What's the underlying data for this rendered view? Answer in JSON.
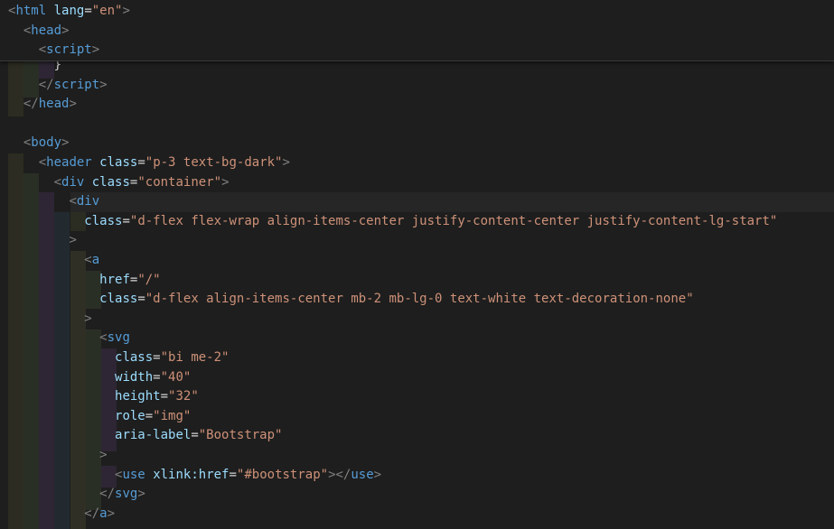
{
  "editor": {
    "language": "html",
    "theme": {
      "background": "#1e1e1e",
      "tag": "#569cd6",
      "attribute": "#9cdcfe",
      "string": "#ce9178",
      "punctuation": "#808080"
    }
  },
  "sticky_lines": [
    {
      "tokens": [
        {
          "t": "punc",
          "v": "<"
        },
        {
          "t": "tag",
          "v": "html"
        },
        {
          "t": "plain",
          "v": " "
        },
        {
          "t": "attr",
          "v": "lang"
        },
        {
          "t": "eq",
          "v": "="
        },
        {
          "t": "str",
          "v": "\"en\""
        },
        {
          "t": "punc",
          "v": ">"
        }
      ]
    },
    {
      "tokens": [
        {
          "t": "plain",
          "v": "  "
        },
        {
          "t": "punc",
          "v": "<"
        },
        {
          "t": "tag",
          "v": "head"
        },
        {
          "t": "punc",
          "v": ">"
        }
      ]
    },
    {
      "tokens": [
        {
          "t": "plain",
          "v": "    "
        },
        {
          "t": "punc",
          "v": "<"
        },
        {
          "t": "tag",
          "v": "script"
        },
        {
          "t": "punc",
          "v": ">"
        }
      ]
    }
  ],
  "lines": [
    {
      "tokens": [
        {
          "t": "plain",
          "v": "      }"
        }
      ]
    },
    {
      "tokens": [
        {
          "t": "plain",
          "v": "    "
        },
        {
          "t": "punc",
          "v": "</"
        },
        {
          "t": "tag",
          "v": "script"
        },
        {
          "t": "punc",
          "v": ">"
        }
      ]
    },
    {
      "tokens": [
        {
          "t": "plain",
          "v": "  "
        },
        {
          "t": "punc",
          "v": "</"
        },
        {
          "t": "tag",
          "v": "head"
        },
        {
          "t": "punc",
          "v": ">"
        }
      ]
    },
    {
      "tokens": []
    },
    {
      "tokens": [
        {
          "t": "plain",
          "v": "  "
        },
        {
          "t": "punc",
          "v": "<"
        },
        {
          "t": "tag",
          "v": "body"
        },
        {
          "t": "punc",
          "v": ">"
        }
      ]
    },
    {
      "tokens": [
        {
          "t": "plain",
          "v": "    "
        },
        {
          "t": "punc",
          "v": "<"
        },
        {
          "t": "tag",
          "v": "header"
        },
        {
          "t": "plain",
          "v": " "
        },
        {
          "t": "attr",
          "v": "class"
        },
        {
          "t": "eq",
          "v": "="
        },
        {
          "t": "str",
          "v": "\"p-3 text-bg-dark\""
        },
        {
          "t": "punc",
          "v": ">"
        }
      ]
    },
    {
      "tokens": [
        {
          "t": "plain",
          "v": "      "
        },
        {
          "t": "punc",
          "v": "<"
        },
        {
          "t": "tag",
          "v": "div"
        },
        {
          "t": "plain",
          "v": " "
        },
        {
          "t": "attr",
          "v": "class"
        },
        {
          "t": "eq",
          "v": "="
        },
        {
          "t": "str",
          "v": "\"container\""
        },
        {
          "t": "punc",
          "v": ">"
        }
      ]
    },
    {
      "tokens": [
        {
          "t": "plain",
          "v": "        "
        },
        {
          "t": "punc",
          "v": "<"
        },
        {
          "t": "tag",
          "v": "div"
        }
      ]
    },
    {
      "tokens": [
        {
          "t": "plain",
          "v": "          "
        },
        {
          "t": "attr",
          "v": "class"
        },
        {
          "t": "eq",
          "v": "="
        },
        {
          "t": "str",
          "v": "\"d-flex flex-wrap align-items-center justify-content-center justify-content-lg-start\""
        }
      ]
    },
    {
      "tokens": [
        {
          "t": "plain",
          "v": "        "
        },
        {
          "t": "punc",
          "v": ">"
        }
      ]
    },
    {
      "tokens": [
        {
          "t": "plain",
          "v": "          "
        },
        {
          "t": "punc",
          "v": "<"
        },
        {
          "t": "tag",
          "v": "a"
        }
      ]
    },
    {
      "tokens": [
        {
          "t": "plain",
          "v": "            "
        },
        {
          "t": "attr",
          "v": "href"
        },
        {
          "t": "eq",
          "v": "="
        },
        {
          "t": "str",
          "v": "\"/\""
        }
      ]
    },
    {
      "tokens": [
        {
          "t": "plain",
          "v": "            "
        },
        {
          "t": "attr",
          "v": "class"
        },
        {
          "t": "eq",
          "v": "="
        },
        {
          "t": "str",
          "v": "\"d-flex align-items-center mb-2 mb-lg-0 text-white text-decoration-none\""
        }
      ]
    },
    {
      "tokens": [
        {
          "t": "plain",
          "v": "          "
        },
        {
          "t": "punc",
          "v": ">"
        }
      ]
    },
    {
      "tokens": [
        {
          "t": "plain",
          "v": "            "
        },
        {
          "t": "punc",
          "v": "<"
        },
        {
          "t": "tag",
          "v": "svg"
        }
      ]
    },
    {
      "tokens": [
        {
          "t": "plain",
          "v": "              "
        },
        {
          "t": "attr",
          "v": "class"
        },
        {
          "t": "eq",
          "v": "="
        },
        {
          "t": "str",
          "v": "\"bi me-2\""
        }
      ]
    },
    {
      "tokens": [
        {
          "t": "plain",
          "v": "              "
        },
        {
          "t": "attr",
          "v": "width"
        },
        {
          "t": "eq",
          "v": "="
        },
        {
          "t": "str",
          "v": "\"40\""
        }
      ]
    },
    {
      "tokens": [
        {
          "t": "plain",
          "v": "              "
        },
        {
          "t": "attr",
          "v": "height"
        },
        {
          "t": "eq",
          "v": "="
        },
        {
          "t": "str",
          "v": "\"32\""
        }
      ]
    },
    {
      "tokens": [
        {
          "t": "plain",
          "v": "              "
        },
        {
          "t": "attr",
          "v": "role"
        },
        {
          "t": "eq",
          "v": "="
        },
        {
          "t": "str",
          "v": "\"img\""
        }
      ]
    },
    {
      "tokens": [
        {
          "t": "plain",
          "v": "              "
        },
        {
          "t": "attr",
          "v": "aria-label"
        },
        {
          "t": "eq",
          "v": "="
        },
        {
          "t": "str",
          "v": "\"Bootstrap\""
        }
      ]
    },
    {
      "tokens": [
        {
          "t": "plain",
          "v": "            "
        },
        {
          "t": "punc",
          "v": ">"
        }
      ]
    },
    {
      "tokens": [
        {
          "t": "plain",
          "v": "              "
        },
        {
          "t": "punc",
          "v": "<"
        },
        {
          "t": "tag",
          "v": "use"
        },
        {
          "t": "plain",
          "v": " "
        },
        {
          "t": "attr",
          "v": "xlink:href"
        },
        {
          "t": "eq",
          "v": "="
        },
        {
          "t": "str",
          "v": "\"#bootstrap\""
        },
        {
          "t": "punc",
          "v": "></"
        },
        {
          "t": "tag",
          "v": "use"
        },
        {
          "t": "punc",
          "v": ">"
        }
      ]
    },
    {
      "tokens": [
        {
          "t": "plain",
          "v": "            "
        },
        {
          "t": "punc",
          "v": "</"
        },
        {
          "t": "tag",
          "v": "svg"
        },
        {
          "t": "punc",
          "v": ">"
        }
      ]
    },
    {
      "tokens": [
        {
          "t": "plain",
          "v": "          "
        },
        {
          "t": "punc",
          "v": "</"
        },
        {
          "t": "tag",
          "v": "a"
        },
        {
          "t": "punc",
          "v": ">"
        }
      ]
    }
  ]
}
